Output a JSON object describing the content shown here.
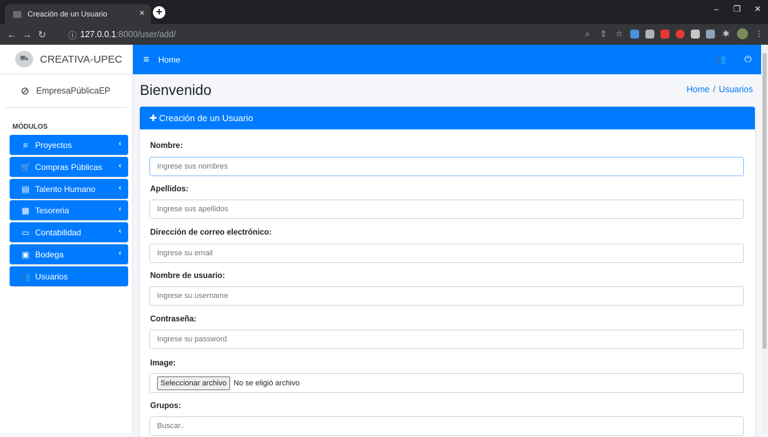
{
  "browser": {
    "tab_title": "Creación de un Usuario",
    "tab_close": "×",
    "new_tab": "+",
    "url_host": "127.0.0.1",
    "url_port": ":8000",
    "url_path": "/user/add/",
    "info_icon": "ⓘ"
  },
  "sidebar": {
    "brand": "CREATIVA-UPEC",
    "user": "EmpresaPúblicaEP",
    "section_header": "MÓDULOS",
    "items": [
      {
        "label": "Proyectos",
        "icon": "≡",
        "chevron": "‹"
      },
      {
        "label": "Compras Públicas",
        "icon": "🛒",
        "chevron": "‹"
      },
      {
        "label": "Talento Humano",
        "icon": "▤",
        "chevron": "‹"
      },
      {
        "label": "Tesoreria",
        "icon": "▦",
        "chevron": "‹"
      },
      {
        "label": "Contabilidad",
        "icon": "▭",
        "chevron": "‹"
      },
      {
        "label": "Bodega",
        "icon": "▣",
        "chevron": "‹"
      },
      {
        "label": "Usuarios",
        "icon": "👥",
        "chevron": ""
      }
    ]
  },
  "topnav": {
    "menu_icon": "≡",
    "home": "Home",
    "users_icon": "👥",
    "power_icon": "⏻"
  },
  "page": {
    "title": "Bienvenido",
    "breadcrumb": [
      "Home",
      "Usuarios"
    ],
    "breadcrumb_sep": "/"
  },
  "card": {
    "header": "Creación de un Usuario",
    "header_icon": "✚",
    "fields": [
      {
        "label": "Nombre:",
        "placeholder": "Ingrese sus nombres"
      },
      {
        "label": "Apellidos:",
        "placeholder": "Ingrese sus apellidos"
      },
      {
        "label": "Dirección de correo electrónico:",
        "placeholder": "Ingrese su email"
      },
      {
        "label": "Nombre de usuario:",
        "placeholder": "Ingrese su username"
      },
      {
        "label": "Contraseña:",
        "placeholder": "Ingrese su password"
      }
    ],
    "image_label": "Image:",
    "file_button": "Seleccionar archivo",
    "file_status": "No se eligió archivo",
    "groups_label": "Grupos:",
    "groups_placeholder": "Buscar.."
  },
  "colors": {
    "primary": "#007bff",
    "chrome_dark": "#202124",
    "chrome_toolbar": "#35363a"
  }
}
